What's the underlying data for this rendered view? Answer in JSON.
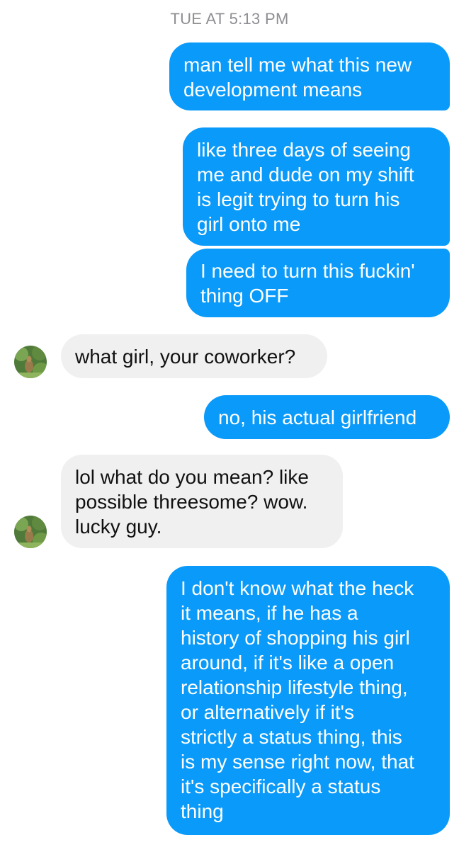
{
  "conversation": {
    "timestamp": "TUE AT 5:13 PM",
    "messages": [
      {
        "direction": "outgoing",
        "text": "man tell me what this new\ndevelopment means"
      },
      {
        "direction": "outgoing",
        "text": "like three days of seeing\nme and dude on my shift\nis legit trying to turn his\ngirl onto me"
      },
      {
        "direction": "outgoing",
        "text": "I need to turn this fuckin'\nthing OFF"
      },
      {
        "direction": "incoming",
        "text": "what girl, your coworker?"
      },
      {
        "direction": "outgoing",
        "text": "no, his actual girlfriend"
      },
      {
        "direction": "incoming",
        "text": "lol what do you mean? like\npossible threesome? wow.\nlucky guy."
      },
      {
        "direction": "outgoing",
        "text": "I don't know what the heck\nit means, if he has a\nhistory of shopping his girl\naround, if it's like a open\nrelationship lifestyle thing,\nor alternatively if it's\nstrictly a status thing, this\nis my sense right now, that\nit's specifically a status\nthing"
      }
    ]
  },
  "colors": {
    "outgoing_bubble": "#0a9af9",
    "incoming_bubble": "#f1f0f0",
    "timestamp_text": "#8e8e93"
  },
  "icons": {
    "contact_avatar": "contact-avatar-photo"
  }
}
